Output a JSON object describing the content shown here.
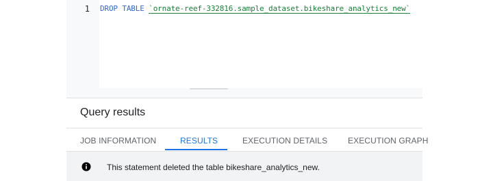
{
  "editor": {
    "line_number": "1",
    "keyword": "DROP TABLE",
    "table_ref": "`ornate-reef-332816.sample_dataset.bikeshare_analytics_new`"
  },
  "results": {
    "title": "Query results",
    "tabs": [
      {
        "label": "JOB INFORMATION",
        "active": false
      },
      {
        "label": "RESULTS",
        "active": true
      },
      {
        "label": "EXECUTION DETAILS",
        "active": false
      },
      {
        "label": "EXECUTION GRAPH",
        "active": false
      }
    ],
    "message": "This statement deleted the table bikeshare_analytics_new.",
    "message_icon": "info-icon"
  },
  "colors": {
    "keyword": "#3367d6",
    "table_ref": "#188038",
    "accent": "#1a73e8"
  }
}
